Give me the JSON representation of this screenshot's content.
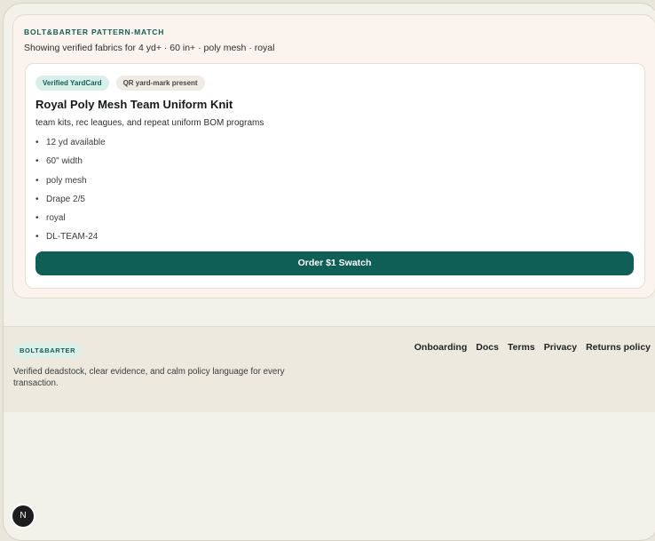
{
  "listing": {
    "eyebrow": "BOLT&BARTER PATTERN-MATCH",
    "subtitle": "Showing verified fabrics for 4 yd+ · 60 in+ · poly mesh · royal",
    "card": {
      "badges": [
        "Verified YardCard",
        "QR yard-mark present"
      ],
      "title": "Royal Poly Mesh Team Uniform Knit",
      "subtitle": "team kits, rec leagues, and repeat uniform BOM programs",
      "specs": [
        "12 yd available",
        "60\" width",
        "poly mesh",
        "Drape 2/5",
        "royal",
        "DL-TEAM-24"
      ],
      "bullet": "•",
      "cta": "Order $1 Swatch"
    }
  },
  "footer": {
    "brand": "BOLT&BARTER",
    "tagline": "Verified deadstock, clear evidence, and calm policy language for every transaction.",
    "links": [
      "Onboarding",
      "Docs",
      "Terms",
      "Privacy",
      "Returns policy"
    ]
  },
  "fab": {
    "label": "N"
  },
  "colors": {
    "accent": "#0f5f56",
    "panel_bg": "#fbf4ee",
    "footer_bg": "#ede9df"
  }
}
